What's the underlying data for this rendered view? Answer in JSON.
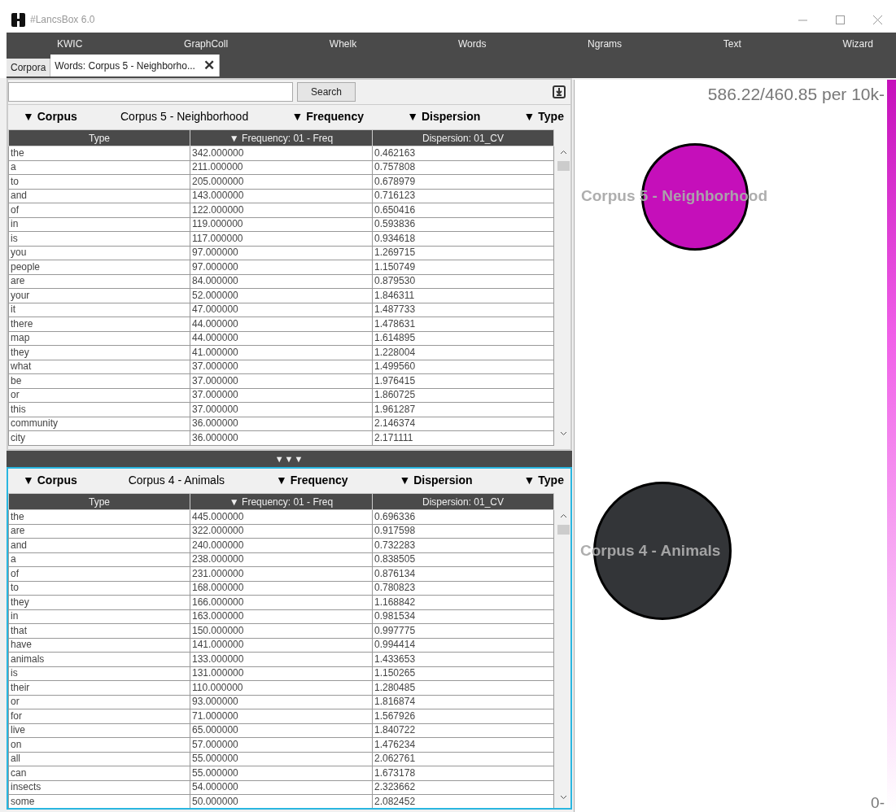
{
  "window": {
    "title": "#LancsBox 6.0"
  },
  "menu": [
    {
      "label": "KWIC"
    },
    {
      "label": "GraphColl"
    },
    {
      "label": "Whelk"
    },
    {
      "label": "Words"
    },
    {
      "label": "Ngrams"
    },
    {
      "label": "Text"
    },
    {
      "label": "Wizard"
    }
  ],
  "tabs": [
    {
      "label": "Corpora",
      "selected": false
    },
    {
      "label": "Words: Corpus  5 - Neighborho...",
      "selected": true,
      "close": "✕"
    }
  ],
  "panels": [
    {
      "focused": false,
      "search": {
        "button": "Search"
      },
      "filters": [
        "▼ Corpus",
        "Corpus  5 - Neighborhood",
        "▼ Frequency",
        "▼ Dispersion",
        "▼ Type"
      ],
      "columns": [
        "Type",
        "▼ Frequency: 01 - Freq",
        "Dispersion: 01_CV"
      ],
      "rows": [
        [
          "the",
          "342.000000",
          "0.462163"
        ],
        [
          "a",
          "211.000000",
          "0.757808"
        ],
        [
          "to",
          "205.000000",
          "0.678979"
        ],
        [
          "and",
          "143.000000",
          "0.716123"
        ],
        [
          "of",
          "122.000000",
          "0.650416"
        ],
        [
          "in",
          "119.000000",
          "0.593836"
        ],
        [
          "is",
          "117.000000",
          "0.934618"
        ],
        [
          "you",
          "97.000000",
          "1.269715"
        ],
        [
          "people",
          "97.000000",
          "1.150749"
        ],
        [
          "are",
          "84.000000",
          "0.879530"
        ],
        [
          "your",
          "52.000000",
          "1.846311"
        ],
        [
          "it",
          "47.000000",
          "1.487733"
        ],
        [
          "there",
          "44.000000",
          "1.478631"
        ],
        [
          "map",
          "44.000000",
          "1.614895"
        ],
        [
          "they",
          "41.000000",
          "1.228004"
        ],
        [
          "what",
          "37.000000",
          "1.499560"
        ],
        [
          "be",
          "37.000000",
          "1.976415"
        ],
        [
          "or",
          "37.000000",
          "1.860725"
        ],
        [
          "this",
          "37.000000",
          "1.961287"
        ],
        [
          "community",
          "36.000000",
          "2.146374"
        ],
        [
          "city",
          "36.000000",
          "2.171111"
        ]
      ]
    },
    {
      "focused": true,
      "filters": [
        "▼ Corpus",
        "Corpus 4 - Animals",
        "▼ Frequency",
        "▼ Dispersion",
        "▼ Type"
      ],
      "columns": [
        "Type",
        "▼ Frequency: 01 - Freq",
        "Dispersion: 01_CV"
      ],
      "rows": [
        [
          "the",
          "445.000000",
          "0.696336"
        ],
        [
          "are",
          "322.000000",
          "0.917598"
        ],
        [
          "and",
          "240.000000",
          "0.732283"
        ],
        [
          "a",
          "238.000000",
          "0.838505"
        ],
        [
          "of",
          "231.000000",
          "0.876134"
        ],
        [
          "to",
          "168.000000",
          "0.780823"
        ],
        [
          "they",
          "166.000000",
          "1.168842"
        ],
        [
          "in",
          "163.000000",
          "0.981534"
        ],
        [
          "that",
          "150.000000",
          "0.997775"
        ],
        [
          "have",
          "141.000000",
          "0.994414"
        ],
        [
          "animals",
          "133.000000",
          "1.433653"
        ],
        [
          "is",
          "131.000000",
          "1.150265"
        ],
        [
          "their",
          "110.000000",
          "1.280485"
        ],
        [
          "or",
          "93.000000",
          "1.816874"
        ],
        [
          "for",
          "71.000000",
          "1.567926"
        ],
        [
          "live",
          "65.000000",
          "1.840722"
        ],
        [
          "on",
          "57.000000",
          "1.476234"
        ],
        [
          "all",
          "55.000000",
          "2.062761"
        ],
        [
          "can",
          "55.000000",
          "1.673178"
        ],
        [
          "insects",
          "54.000000",
          "2.323662"
        ],
        [
          "some",
          "50.000000",
          "2.082452"
        ]
      ]
    }
  ],
  "splitter": "▼▼▼",
  "graph": {
    "scale_max": "586.22/460.85 per 10k-",
    "scale_min": "0-",
    "bubbles": [
      {
        "label": "Corpus  5 - Neighborhood",
        "color": "#c50fba"
      },
      {
        "label": "Corpus 4 - Animals",
        "color": "#333538"
      }
    ]
  }
}
